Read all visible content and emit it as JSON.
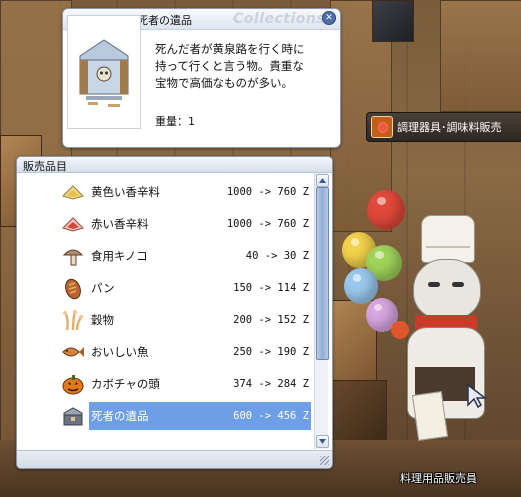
{
  "item_info": {
    "title": "死者の遺品",
    "watermark": "Collections",
    "close": "✕",
    "description": "死んだ者が黄泉路を行く時に\n持って行くと言う物。貴重な\n宝物で高価なものが多い。",
    "weight": "重量：1"
  },
  "shop_tag": {
    "label": "調理器具･調味料販売"
  },
  "shop": {
    "title": "販売品目",
    "selected_index": 7,
    "scroll": {
      "visible_fraction": 0.69,
      "position_fraction": 0.0
    },
    "items": [
      {
        "name": "黄色い香辛料",
        "price": "1000 -> 760 Z",
        "icon": "yellow-spice-icon",
        "color": "#e8c04a"
      },
      {
        "name": "赤い香辛料",
        "price": "1000 -> 760 Z",
        "icon": "red-spice-icon",
        "color": "#d9453a"
      },
      {
        "name": "食用キノコ",
        "price": "40 -> 30 Z",
        "icon": "mushroom-icon",
        "color": "#b08a6a"
      },
      {
        "name": "パン",
        "price": "150 -> 114 Z",
        "icon": "bread-icon",
        "color": "#b8662e"
      },
      {
        "name": "穀物",
        "price": "200 -> 152 Z",
        "icon": "grain-icon",
        "color": "#e0b070"
      },
      {
        "name": "おいしい魚",
        "price": "250 -> 190 Z",
        "icon": "fish-icon",
        "color": "#d0853a"
      },
      {
        "name": "カボチャの頭",
        "price": "374 -> 284 Z",
        "icon": "pumpkin-head-icon",
        "color": "#e07a1a"
      },
      {
        "name": "死者の遺品",
        "price": "600 -> 456 Z",
        "icon": "relic-chest-icon",
        "color": "#6d7480"
      }
    ]
  },
  "npc": {
    "name": "料理用品販売員"
  }
}
